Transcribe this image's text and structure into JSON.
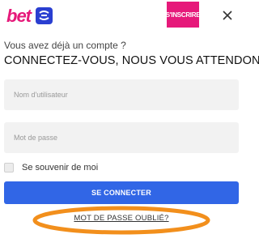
{
  "header": {
    "logo_text": "bet",
    "register_label": "S'INSCRIRE",
    "close_icon": "close-icon"
  },
  "colors": {
    "logo_text": "#e6197a",
    "logo_badge": "#2a3fd1",
    "register_bg": "#e6197a",
    "login_bg": "#3166e6",
    "highlight": "#f28f1c"
  },
  "login": {
    "subtitle": "Vous avez déjà un compte ?",
    "title": "CONNECTEZ-VOUS, NOUS VOUS ATTENDONS",
    "username_placeholder": "Nom d'utilisateur",
    "username_value": "",
    "password_placeholder": "Mot de passe",
    "password_value": "",
    "remember_label": "Se souvenir de moi",
    "remember_checked": false,
    "submit_label": "SE CONNECTER",
    "forgot_label": "MOT DE PASSE OUBLIÉ?"
  }
}
